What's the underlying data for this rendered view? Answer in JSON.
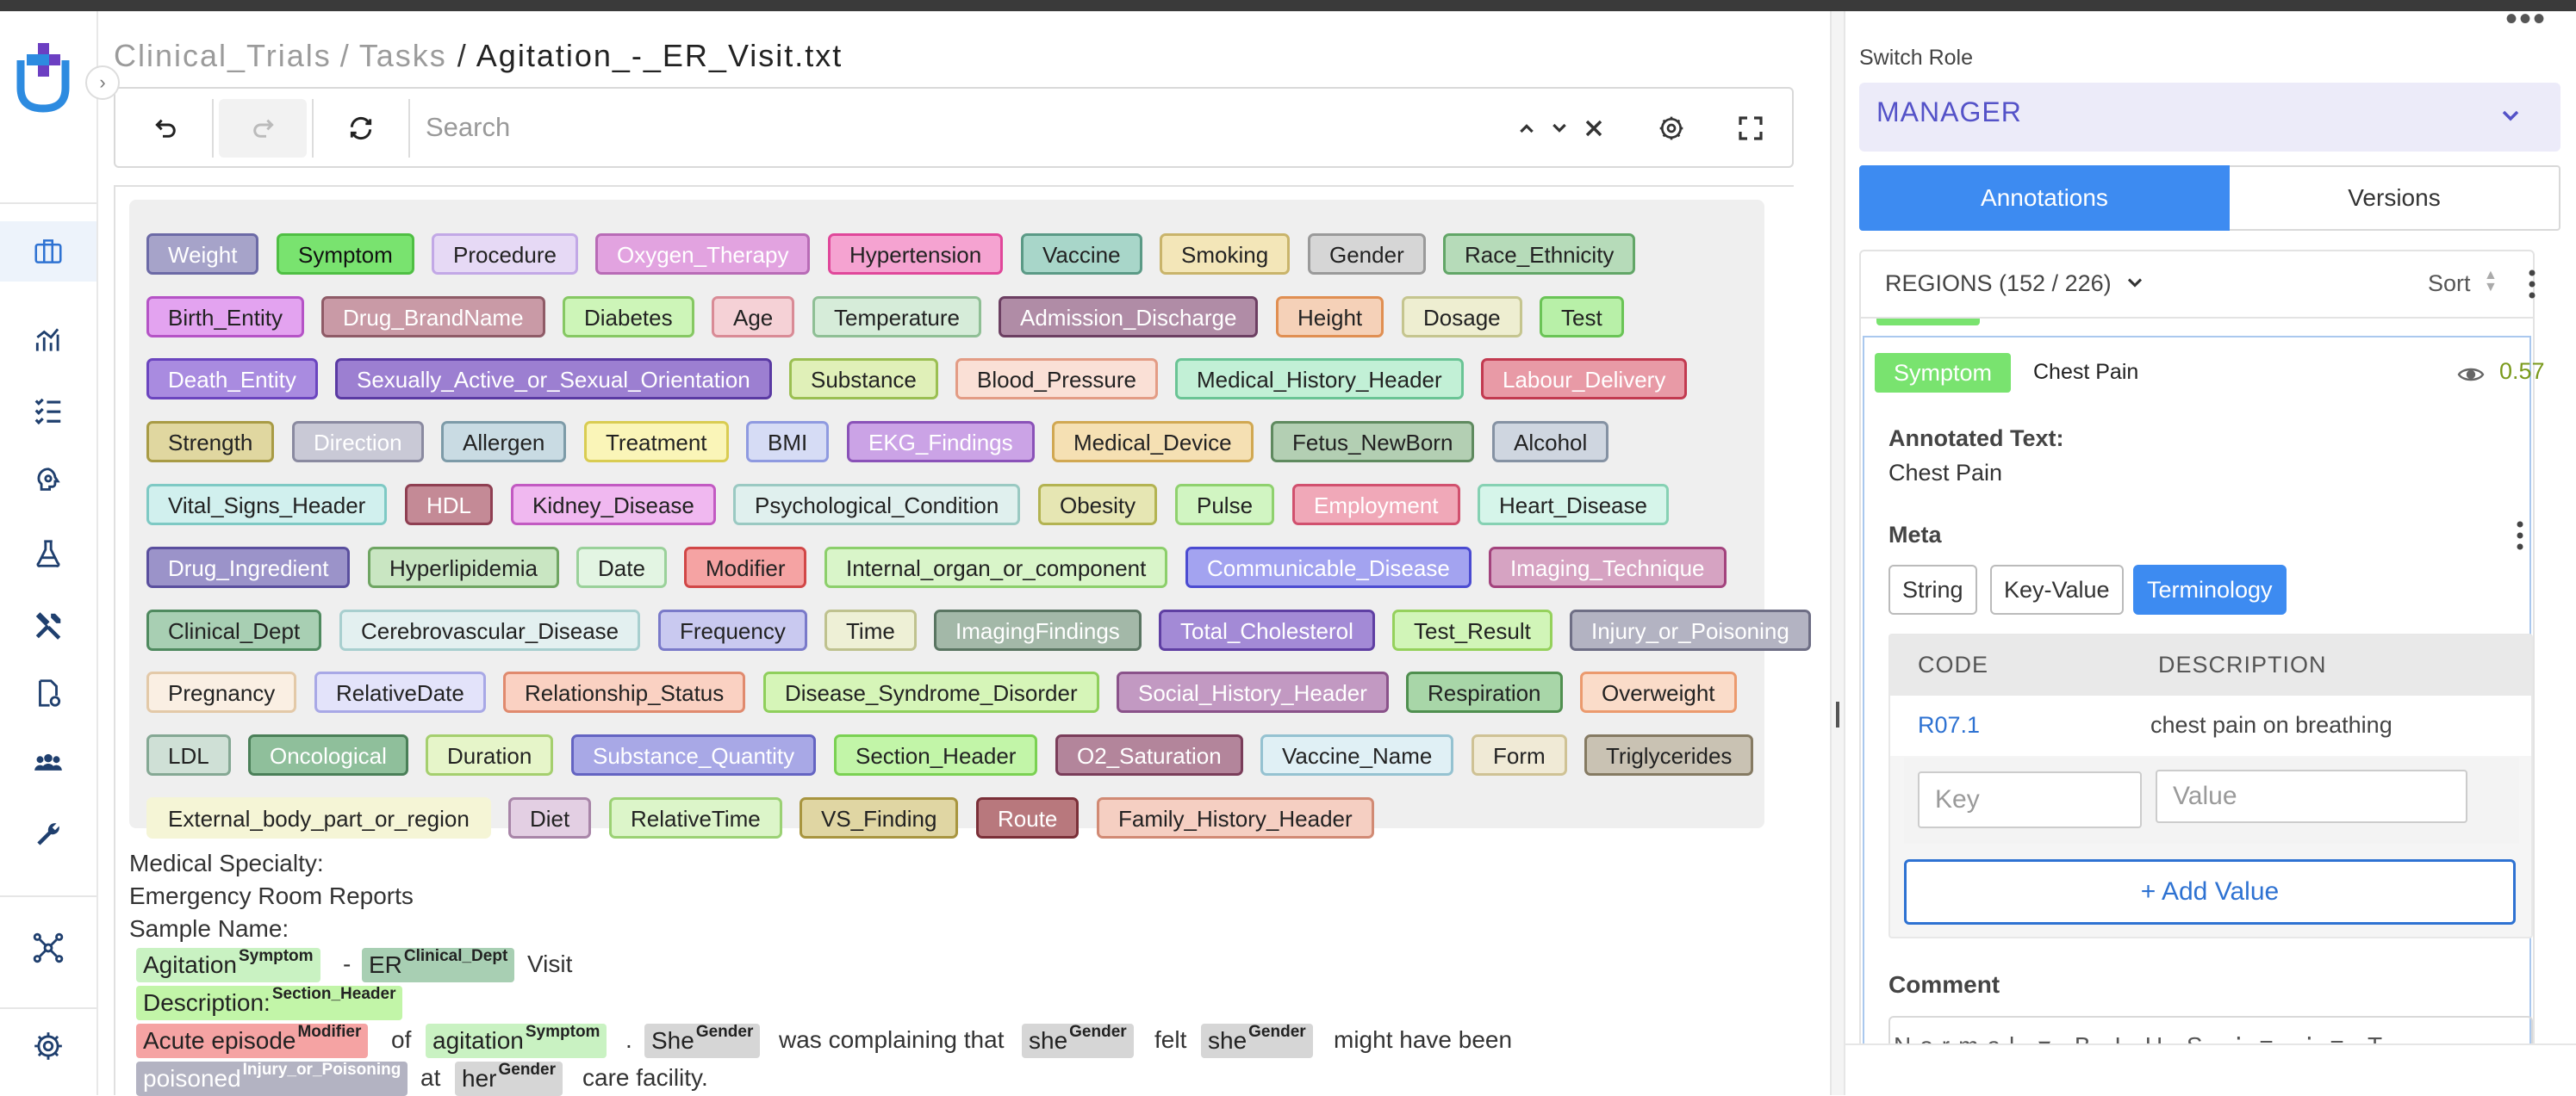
{
  "breadcrumb": {
    "project": "Clinical_Trials",
    "section": "Tasks",
    "file": "Agitation_-_ER_Visit.txt",
    "sep": "/"
  },
  "toolbar": {
    "search_placeholder": "Search"
  },
  "labels": [
    {
      "text": "Weight",
      "bg": "#a6a3c9",
      "border": "#6c6aa6",
      "color": "#ffffff"
    },
    {
      "text": "Symptom",
      "bg": "#79e36f",
      "border": "#4fbf43",
      "color": "#111111"
    },
    {
      "text": "Procedure",
      "bg": "#e6d9f5",
      "border": "#c2a8e6",
      "color": "#222222"
    },
    {
      "text": "Oxygen_Therapy",
      "bg": "#e2a3e0",
      "border": "#b86bb6",
      "color": "#ffffff"
    },
    {
      "text": "Hypertension",
      "bg": "#f5a3d1",
      "border": "#e0479a",
      "color": "#222222"
    },
    {
      "text": "Vaccine",
      "bg": "#a8d6c9",
      "border": "#5b9a86",
      "color": "#222222"
    },
    {
      "text": "Smoking",
      "bg": "#f3e6b8",
      "border": "#c9b46b",
      "color": "#222222"
    },
    {
      "text": "Gender",
      "bg": "#d6d6d6",
      "border": "#9a9a9a",
      "color": "#222222"
    },
    {
      "text": "Race_Ethnicity",
      "bg": "#b6dbb9",
      "border": "#62a667",
      "color": "#222222"
    },
    {
      "text": "Birth_Entity",
      "bg": "#e3a3f0",
      "border": "#b553c6",
      "color": "#222222"
    },
    {
      "text": "Drug_BrandName",
      "bg": "#c99aa6",
      "border": "#8f5b67",
      "color": "#ffffff"
    },
    {
      "text": "Diabetes",
      "bg": "#cdf5b8",
      "border": "#86c863",
      "color": "#222222"
    },
    {
      "text": "Age",
      "bg": "#f5d1d6",
      "border": "#d98b96",
      "color": "#222222"
    },
    {
      "text": "Temperature",
      "bg": "#d6ecd9",
      "border": "#8fbf95",
      "color": "#222222"
    },
    {
      "text": "Admission_Discharge",
      "bg": "#b08ca6",
      "border": "#6c3f62",
      "color": "#ffffff"
    },
    {
      "text": "Height",
      "bg": "#f5d1b8",
      "border": "#e08f52",
      "color": "#222222"
    },
    {
      "text": "Dosage",
      "bg": "#eeeed1",
      "border": "#c5c58f",
      "color": "#222222"
    },
    {
      "text": "Test",
      "bg": "#b8f0a8",
      "border": "#6ac456",
      "color": "#222222"
    },
    {
      "text": "Death_Entity",
      "bg": "#a98be0",
      "border": "#6b45bf",
      "color": "#ffffff"
    },
    {
      "text": "Sexually_Active_or_Sexual_Orientation",
      "bg": "#9c7fd1",
      "border": "#5a3aa3",
      "color": "#ffffff"
    },
    {
      "text": "Substance",
      "bg": "#e0f0b8",
      "border": "#9bbf52",
      "color": "#222222"
    },
    {
      "text": "Blood_Pressure",
      "bg": "#fae0d6",
      "border": "#e39c85",
      "color": "#222222"
    },
    {
      "text": "Medical_History_Header",
      "bg": "#c2f0d6",
      "border": "#6ac495",
      "color": "#222222"
    },
    {
      "text": "Labour_Delivery",
      "bg": "#e89aa6",
      "border": "#c23a50",
      "color": "#ffffff"
    },
    {
      "text": "Strength",
      "bg": "#e0d7a0",
      "border": "#a89b45",
      "color": "#222222"
    },
    {
      "text": "Direction",
      "bg": "#c9c9d6",
      "border": "#8a8aa0",
      "color": "#ffffff"
    },
    {
      "text": "Allergen",
      "bg": "#c9dbe3",
      "border": "#7d9ba8",
      "color": "#222222"
    },
    {
      "text": "Treatment",
      "bg": "#faf5b8",
      "border": "#d9cc52",
      "color": "#222222"
    },
    {
      "text": "BMI",
      "bg": "#d6dcf5",
      "border": "#8f9ae0",
      "color": "#222222"
    },
    {
      "text": "EKG_Findings",
      "bg": "#cba3e6",
      "border": "#8a52b8",
      "color": "#ffffff"
    },
    {
      "text": "Medical_Device",
      "bg": "#f5e0b3",
      "border": "#d1a852",
      "color": "#222222"
    },
    {
      "text": "Fetus_NewBorn",
      "bg": "#b3cfb3",
      "border": "#5f8a5f",
      "color": "#222222"
    },
    {
      "text": "Alcohol",
      "bg": "#cfd6e0",
      "border": "#8592a3",
      "color": "#222222"
    },
    {
      "text": "Vital_Signs_Header",
      "bg": "#d1f0ee",
      "border": "#7ec9c4",
      "color": "#222222"
    },
    {
      "text": "HDL",
      "bg": "#c48a96",
      "border": "#8f3f52",
      "color": "#ffffff"
    },
    {
      "text": "Kidney_Disease",
      "bg": "#f0b8f0",
      "border": "#c25ac2",
      "color": "#222222"
    },
    {
      "text": "Psychological_Condition",
      "bg": "#e0f0ee",
      "border": "#9ac9c2",
      "color": "#222222"
    },
    {
      "text": "Obesity",
      "bg": "#e6e6b3",
      "border": "#b3b352",
      "color": "#222222"
    },
    {
      "text": "Pulse",
      "bg": "#d1f5c2",
      "border": "#8fd16e",
      "color": "#222222"
    },
    {
      "text": "Employment",
      "bg": "#f0a8b8",
      "border": "#d1506e",
      "color": "#ffffff"
    },
    {
      "text": "Heart_Disease",
      "bg": "#d6f5ea",
      "border": "#86d1b3",
      "color": "#222222"
    },
    {
      "text": "Drug_Ingredient",
      "bg": "#9b93c9",
      "border": "#5a4f9e",
      "color": "#ffffff"
    },
    {
      "text": "Hyperlipidemia",
      "bg": "#c9e6c2",
      "border": "#6fa562",
      "color": "#222222"
    },
    {
      "text": "Date",
      "bg": "#e3f5e3",
      "border": "#9ad19a",
      "color": "#222222"
    },
    {
      "text": "Modifier",
      "bg": "#f5a3a3",
      "border": "#d14747",
      "color": "#222222"
    },
    {
      "text": "Internal_organ_or_component",
      "bg": "#d9f5c9",
      "border": "#8ccf6b",
      "color": "#222222"
    },
    {
      "text": "Communicable_Disease",
      "bg": "#a3a3f0",
      "border": "#4b4bd1",
      "color": "#ffffff"
    },
    {
      "text": "Imaging_Technique",
      "bg": "#d6a3c2",
      "border": "#a3437d",
      "color": "#ffffff"
    },
    {
      "text": "Clinical_Dept",
      "bg": "#a8cfb3",
      "border": "#4f8a5f",
      "color": "#222222"
    },
    {
      "text": "Cerebrovascular_Disease",
      "bg": "#e3f0f0",
      "border": "#a8cfcf",
      "color": "#222222"
    },
    {
      "text": "Frequency",
      "bg": "#c9c9f0",
      "border": "#7a7ac9",
      "color": "#222222"
    },
    {
      "text": "Time",
      "bg": "#eef0d6",
      "border": "#bfc28f",
      "color": "#222222"
    },
    {
      "text": "ImagingFindings",
      "bg": "#a3b8a8",
      "border": "#5a7562",
      "color": "#ffffff"
    },
    {
      "text": "Total_Cholesterol",
      "bg": "#a38ad6",
      "border": "#5f3fa3",
      "color": "#ffffff"
    },
    {
      "text": "Test_Result",
      "bg": "#d1f5b8",
      "border": "#95d15c",
      "color": "#222222"
    },
    {
      "text": "Injury_or_Poisoning",
      "bg": "#b3b3c2",
      "border": "#6e6e85",
      "color": "#ffffff"
    },
    {
      "text": "Pregnancy",
      "bg": "#faefe3",
      "border": "#e3c9a8",
      "color": "#222222"
    },
    {
      "text": "RelativeDate",
      "bg": "#e3e3fa",
      "border": "#a8a8e6",
      "color": "#222222"
    },
    {
      "text": "Relationship_Status",
      "bg": "#fad1c2",
      "border": "#e08a6e",
      "color": "#222222"
    },
    {
      "text": "Disease_Syndrome_Disorder",
      "bg": "#d6f5b8",
      "border": "#8fcf5c",
      "color": "#222222"
    },
    {
      "text": "Social_History_Header",
      "bg": "#c299c2",
      "border": "#8a528a",
      "color": "#ffffff"
    },
    {
      "text": "Respiration",
      "bg": "#a8d6a8",
      "border": "#4f8f4f",
      "color": "#222222"
    },
    {
      "text": "Overweight",
      "bg": "#fadcc9",
      "border": "#eb9a6e",
      "color": "#222222"
    },
    {
      "text": "LDL",
      "bg": "#cfe0d6",
      "border": "#85a894",
      "color": "#222222"
    },
    {
      "text": "Oncological",
      "bg": "#8fbf9b",
      "border": "#4a7f58",
      "color": "#ffffff"
    },
    {
      "text": "Duration",
      "bg": "#e6f5c9",
      "border": "#a5cf6e",
      "color": "#222222"
    },
    {
      "text": "Substance_Quantity",
      "bg": "#a8a8e6",
      "border": "#6464c2",
      "color": "#ffffff"
    },
    {
      "text": "Section_Header",
      "bg": "#c2f5a8",
      "border": "#7ad152",
      "color": "#222222"
    },
    {
      "text": "O2_Saturation",
      "bg": "#b3859b",
      "border": "#7a3d5a",
      "color": "#ffffff"
    },
    {
      "text": "Vaccine_Name",
      "bg": "#e0f0f5",
      "border": "#95c2d1",
      "color": "#222222"
    },
    {
      "text": "Form",
      "bg": "#f0ead6",
      "border": "#cfc295",
      "color": "#222222"
    },
    {
      "text": "Triglycerides",
      "bg": "#c9c2b3",
      "border": "#857a62",
      "color": "#222222"
    },
    {
      "text": "External_body_part_or_region",
      "bg": "#f5f5d6",
      "border": "#f5f5d6",
      "color": "#222222"
    },
    {
      "text": "Diet",
      "bg": "#e3cfe3",
      "border": "#a885a8",
      "color": "#222222"
    },
    {
      "text": "RelativeTime",
      "bg": "#dcf5c9",
      "border": "#9bd174",
      "color": "#222222"
    },
    {
      "text": "VS_Finding",
      "bg": "#e0d6a3",
      "border": "#a8953f",
      "color": "#222222"
    },
    {
      "text": "Route",
      "bg": "#b8787d",
      "border": "#7a2f38",
      "color": "#ffffff"
    },
    {
      "text": "Family_History_Header",
      "bg": "#f5cfc2",
      "border": "#d18a74",
      "color": "#222222"
    }
  ],
  "document": {
    "lines": [
      "Medical Specialty:",
      "Emergency Room Reports",
      "Sample Name:"
    ],
    "tokens": {
      "agitation": "Agitation",
      "dash": "-",
      "er": "ER",
      "visit": "Visit",
      "description": "Description:",
      "acute": "Acute episode",
      "of": "of",
      "agitation2": "agitation",
      "dot": ".",
      "she": "She",
      "complaining": "was complaining that",
      "she2": "she",
      "felt": "felt",
      "she3": "she",
      "might": "might have been",
      "poisoned": "poisoned",
      "at": "at",
      "her": "her",
      "care": "care facility."
    },
    "tags": {
      "symptom": "Symptom",
      "clinical_dept": "Clinical_Dept",
      "section_header": "Section_Header",
      "modifier": "Modifier",
      "gender": "Gender",
      "injury": "Injury_or_Poisoning"
    }
  },
  "right_panel": {
    "switch_role_label": "Switch Role",
    "role_value": "MANAGER",
    "tabs": {
      "annotations": "Annotations",
      "versions": "Versions"
    },
    "regions_title": "REGIONS (152 / 226)",
    "sort_label": "Sort",
    "region": {
      "label": "Symptom",
      "text": "Chest Pain",
      "score": "0.57",
      "annotated_text_label": "Annotated Text:",
      "annotated_text_value": "Chest Pain",
      "meta_label": "Meta",
      "meta_tabs": [
        "String",
        "Key-Value",
        "Terminology"
      ],
      "table_headers": {
        "code": "CODE",
        "description": "DESCRIPTION"
      },
      "rows": [
        {
          "code": "R07.1",
          "description": "chest pain on breathing"
        }
      ],
      "key_placeholder": "Key",
      "value_placeholder": "Value",
      "add_value": "+ Add Value",
      "comment_label": "Comment"
    }
  },
  "colors": {
    "accent": "#3d8bf1",
    "symptom": "#79e36f",
    "role_text": "#5452c8"
  }
}
